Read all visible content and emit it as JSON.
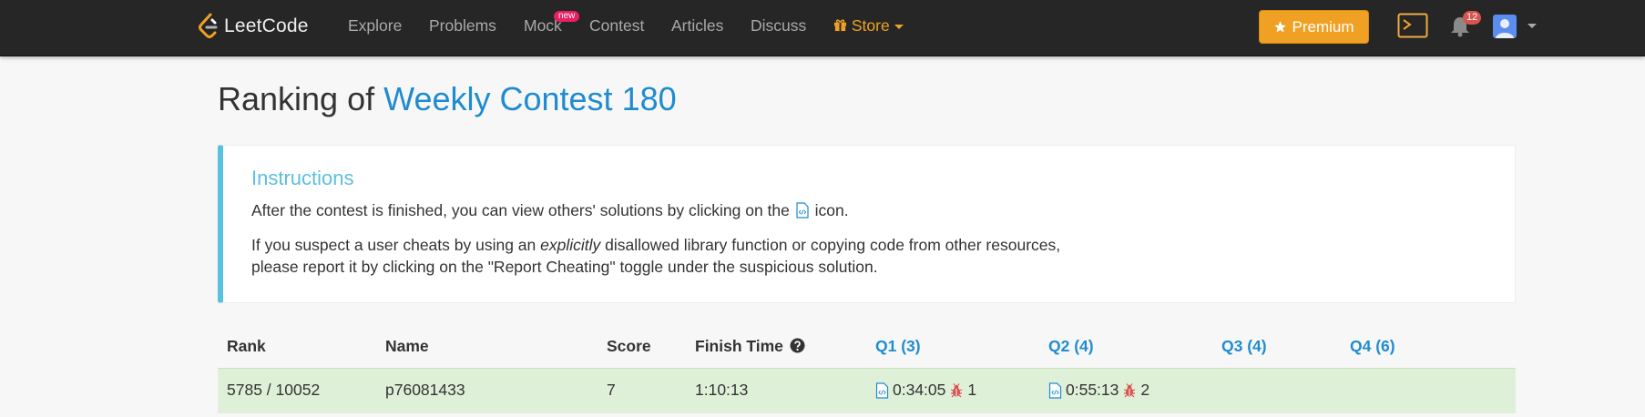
{
  "nav": {
    "brand": "LeetCode",
    "items": [
      "Explore",
      "Problems",
      "Mock",
      "Contest",
      "Articles",
      "Discuss",
      "Store"
    ],
    "mock_badge": "new",
    "premium_label": "Premium",
    "notification_count": "12"
  },
  "page": {
    "title_prefix": "Ranking of",
    "title_link": "Weekly Contest 180"
  },
  "instructions": {
    "title": "Instructions",
    "line1_before": "After the contest is finished, you can view others' solutions by clicking on the",
    "line1_after": "icon.",
    "line2_before": "If you suspect a user cheats by using an",
    "line2_emphasis": "explicitly",
    "line2_after": "disallowed library function or copying code from other resources,",
    "line3": "please report it by clicking on the \"Report Cheating\" toggle under the suspicious solution."
  },
  "table": {
    "headers": {
      "rank": "Rank",
      "name": "Name",
      "score": "Score",
      "finish_time": "Finish Time",
      "q1": "Q1 (3)",
      "q2": "Q2 (4)",
      "q3": "Q3 (4)",
      "q4": "Q4 (6)"
    },
    "rows": [
      {
        "rank": "5785 / 10052",
        "name": "p76081433",
        "score": "7",
        "finish_time": "1:10:13",
        "q1_time": "0:34:05",
        "q1_bugs": "1",
        "q2_time": "0:55:13",
        "q2_bugs": "2"
      }
    ]
  },
  "colors": {
    "navbar": "#262626",
    "accent_blue": "#1f8ccf",
    "premium": "#f0a124",
    "info": "#5bc0de",
    "success_row": "#dff0d8",
    "bug": "#d9534f"
  }
}
